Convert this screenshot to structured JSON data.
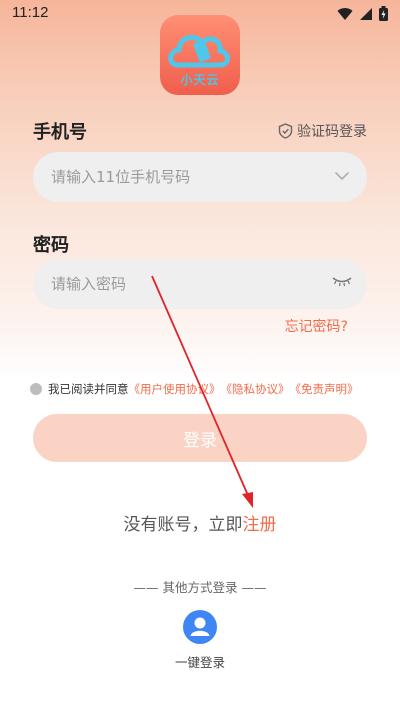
{
  "status_bar": {
    "time": "11:12"
  },
  "app": {
    "logo_text": "小天云"
  },
  "phone": {
    "label": "手机号",
    "placeholder": "请输入11位手机号码"
  },
  "sms_login": {
    "label": "验证码登录"
  },
  "password": {
    "label": "密码",
    "placeholder": "请输入密码"
  },
  "forgot": {
    "label": "忘记密码?"
  },
  "agreement": {
    "prefix": "我已阅读并同意",
    "user_agreement": "《用户使用协议》",
    "privacy": "《隐私协议》",
    "disclaimer": "《免责声明》"
  },
  "login_button": {
    "label": "登录"
  },
  "register": {
    "prompt": "没有账号，立即",
    "link": "注册"
  },
  "other_login": {
    "title": "—— 其他方式登录 ——",
    "one_key_label": "一键登录"
  },
  "colors": {
    "accent": "#f36b4a",
    "button_disabled": "#fbd3c4",
    "one_key": "#3d86f4"
  }
}
